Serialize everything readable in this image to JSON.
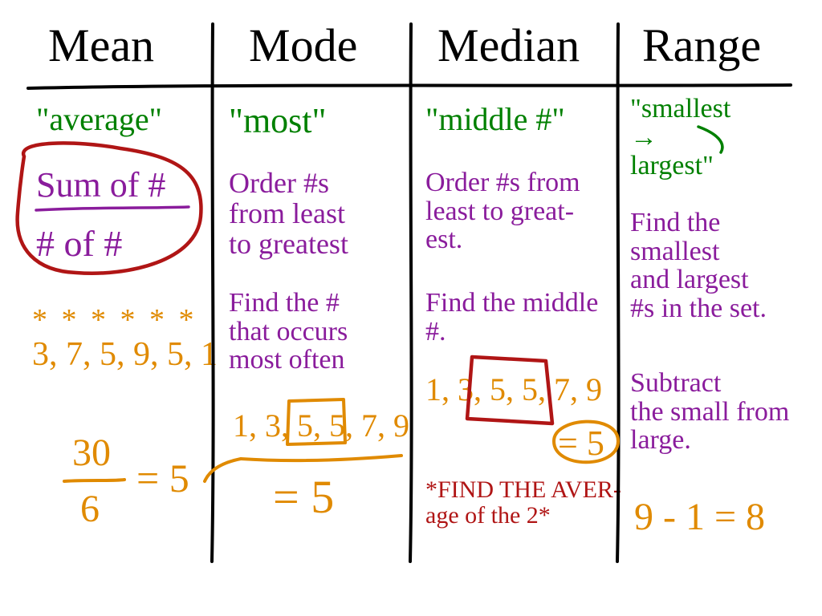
{
  "columns": {
    "mean": {
      "title": "Mean",
      "keyword": "\"average\"",
      "formula_top": "Sum of #",
      "formula_bottom": "# of #",
      "sample_stars": "* * * * * *",
      "sample_set": "3, 7, 5, 9, 5, 1",
      "work_numerator": "30",
      "work_denominator": "6",
      "result": "= 5"
    },
    "mode": {
      "title": "Mode",
      "keyword": "\"most\"",
      "step1": "Order #s\nfrom least\nto greatest",
      "step2": "Find the #\nthat occurs\nmost often",
      "ordered_set": "1, 3, 5, 5, 7, 9",
      "result": "= 5"
    },
    "median": {
      "title": "Median",
      "keyword": "\"middle #\"",
      "step1": "Order #s from\nleast to great-\nest.",
      "step2": "Find the middle\n#.",
      "ordered_set": "1, 3, 5, 5, 7, 9",
      "result": "= 5",
      "note": "*FIND THE AVER-\n  age of the 2*"
    },
    "range": {
      "title": "Range",
      "keyword": "\"smallest\n   →\n largest\"",
      "step1": "Find the\nsmallest\nand largest\n#s in the set.",
      "step2": "Subtract\nthe small from\nlarge.",
      "work": "9 - 1 = 8"
    }
  }
}
